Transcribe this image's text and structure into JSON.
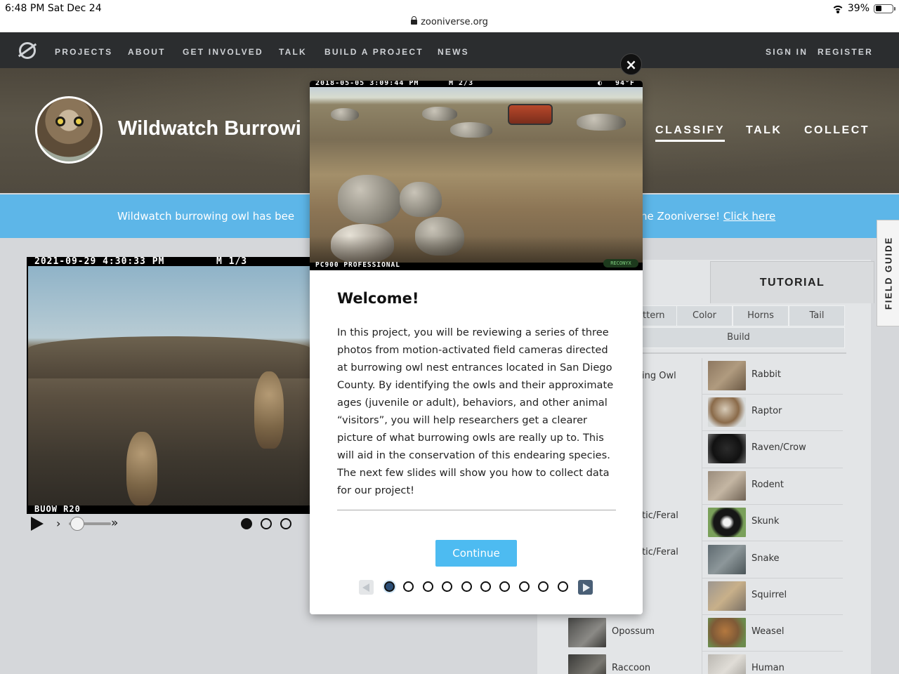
{
  "status_bar": {
    "time": "6:48 PM   Sat Dec 24",
    "url": "zooniverse.org",
    "battery": "39%",
    "battery_level": 0.39
  },
  "nav": {
    "links": [
      "PROJECTS",
      "ABOUT",
      "GET INVOLVED",
      "TALK",
      "BUILD A PROJECT",
      "NEWS"
    ],
    "sign_in": "SIGN IN",
    "register": "REGISTER"
  },
  "hero": {
    "title": "Wildwatch Burrowi",
    "tabs": [
      "CLASSIFY",
      "TALK",
      "COLLECT"
    ],
    "active_tab": "CLASSIFY"
  },
  "banner": {
    "text": "Wildwatch burrowing owl has bee",
    "text_right": "he Zooniverse! ",
    "link": "Click here"
  },
  "subject": {
    "timestamp": "2021-09-29 4:30:33 PM",
    "frame": "M 1/3",
    "camera_id": "BUOW R20",
    "frames_total": 3,
    "current_frame": 1
  },
  "field_guide": {
    "label": "FIELD GUIDE"
  },
  "task": {
    "tutorial_label": "TUTORIAL",
    "filters_row1": [
      "ttern",
      "Color",
      "Horns",
      "Tail"
    ],
    "filters_row2": [
      "Build"
    ],
    "left_column": [
      "ing Owl",
      "",
      "",
      "",
      "tic/Feral",
      "tic/Feral",
      "",
      "Opossum",
      "Raccoon"
    ],
    "right_column": [
      "Rabbit",
      "Raptor",
      "Raven/Crow",
      "Rodent",
      "Skunk",
      "Snake",
      "Squirrel",
      "Weasel",
      "Human"
    ]
  },
  "modal": {
    "image_timestamp": "2018-05-05 3:09:44 PM",
    "image_frame": "M 2/3",
    "image_temp": "94°F",
    "image_camera": "PC900 PROFESSIONAL",
    "image_brand": "RECONYX",
    "close_label": "×",
    "title": "Welcome!",
    "body": "In this project, you will be reviewing a series of three photos from motion-activated field cameras directed at burrowing owl nest entrances located in San Diego County. By identifying the owls and their approximate ages (juvenile or adult), behaviors, and other animal “visitors”, you will help researchers get a clearer picture of what burrowing owls are really up to. This will aid in the conservation of this endearing species. The next few slides will show you how to collect data for our project!",
    "continue_label": "Continue",
    "steps_total": 10,
    "current_step": 1
  }
}
